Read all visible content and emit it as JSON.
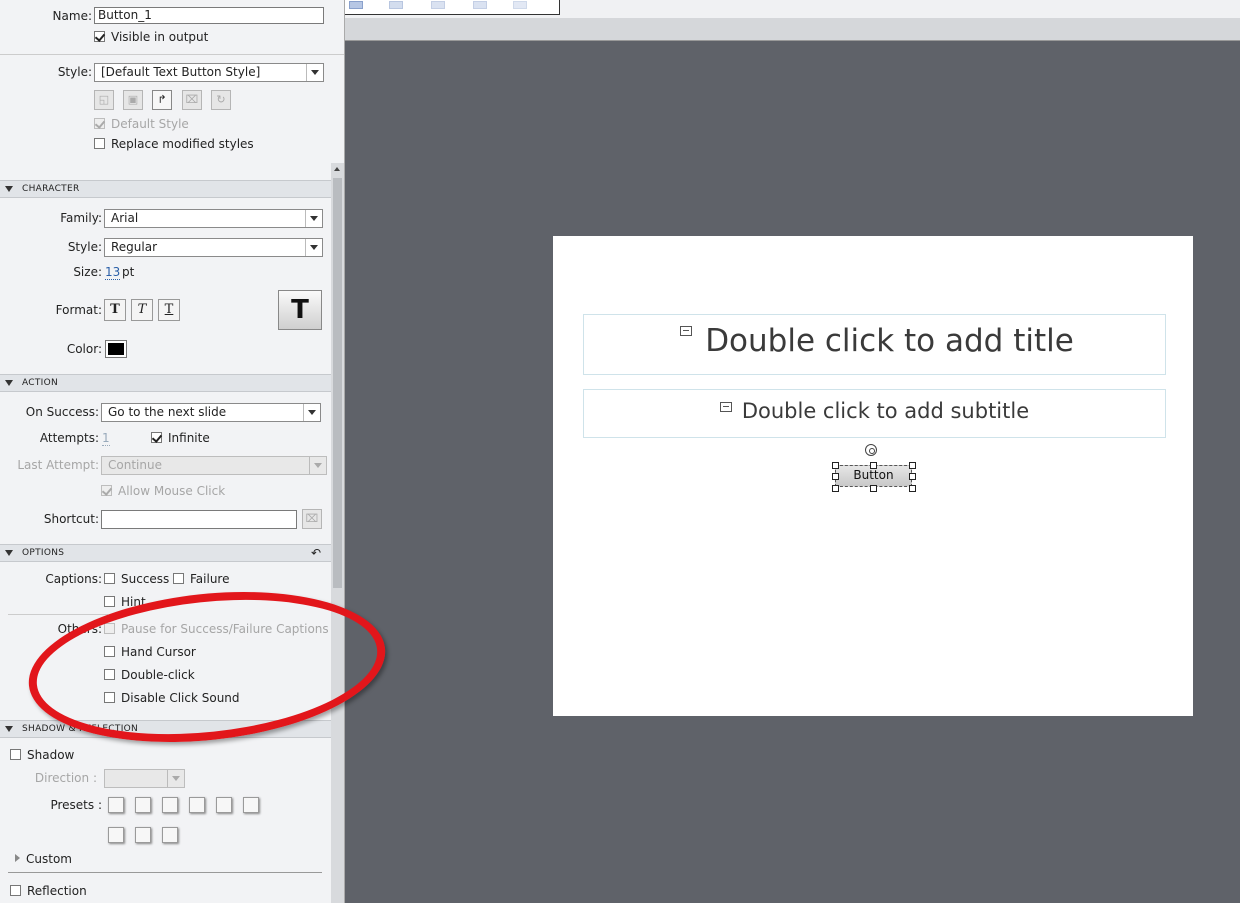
{
  "name": {
    "label": "Name:",
    "value": "Button_1"
  },
  "visible_output": {
    "label": "Visible in output",
    "checked": true
  },
  "style_row": {
    "label": "Style:",
    "value": "[Default Text Button Style]"
  },
  "default_style": {
    "label": "Default Style",
    "checked": true,
    "disabled": true
  },
  "replace_styles": {
    "label": "Replace modified styles",
    "checked": false
  },
  "character": {
    "header": "CHARACTER",
    "family_label": "Family:",
    "family_value": "Arial",
    "style_label": "Style:",
    "style_value": "Regular",
    "size_label": "Size:",
    "size_value": "13",
    "size_unit": "pt",
    "format_label": "Format:",
    "format_buttons": [
      "T",
      "T",
      "T"
    ],
    "big_t": "T",
    "color_label": "Color:",
    "color_value": "#000000"
  },
  "action": {
    "header": "ACTION",
    "on_success_label": "On Success:",
    "on_success_value": "Go to the next slide",
    "attempts_label": "Attempts:",
    "attempts_value": "1",
    "infinite_label": "Infinite",
    "infinite_checked": true,
    "last_attempt_label": "Last Attempt:",
    "last_attempt_value": "Continue",
    "allow_mouse_label": "Allow Mouse Click",
    "shortcut_label": "Shortcut:",
    "shortcut_value": ""
  },
  "options": {
    "header": "OPTIONS",
    "captions_label": "Captions:",
    "success_label": "Success",
    "failure_label": "Failure",
    "hint_label": "Hint",
    "others_label": "Others:",
    "pause_label": "Pause for Success/Failure Captions",
    "hand_cursor_label": "Hand Cursor",
    "double_click_label": "Double-click",
    "disable_sound_label": "Disable Click Sound"
  },
  "shadow": {
    "header": "SHADOW & REFLECTION",
    "shadow_label": "Shadow",
    "direction_label": "Direction :",
    "presets_label": "Presets :",
    "custom_label": "Custom",
    "reflection_label": "Reflection"
  },
  "slide": {
    "title_text": "Double click to add title",
    "subtitle_text": "Double click to add subtitle",
    "button_label": "Button"
  },
  "colors": {
    "annotation": "#e2161b",
    "stage": "#5f6269",
    "panel": "#f2f3f5"
  }
}
